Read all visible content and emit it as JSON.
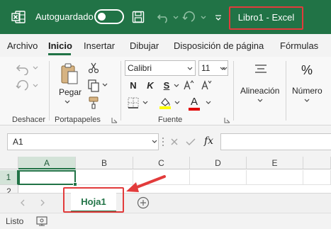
{
  "titlebar": {
    "app_icon": "excel-logo-icon",
    "autosave_label": "Autoguardado",
    "autosave_state": "off",
    "title": "Libro1  -  Excel",
    "bg_color": "#217346",
    "highlight_color": "#e23b3b"
  },
  "menu": {
    "tabs": [
      "Archivo",
      "Inicio",
      "Insertar",
      "Dibujar",
      "Disposición de página",
      "Fórmulas"
    ],
    "active": "Inicio"
  },
  "ribbon": {
    "groups": {
      "undo": "Deshacer",
      "clipboard": "Portapapeles",
      "font": "Fuente"
    },
    "paste_label": "Pegar",
    "font_name": "Calibri",
    "font_size": "11",
    "bold": "N",
    "italic": "K",
    "underline": "S",
    "font_color_letter": "A",
    "align_label": "Alineación",
    "number_label": "Número",
    "percent_symbol": "%"
  },
  "formula_bar": {
    "name_box": "A1",
    "fx_label": "fx",
    "value": ""
  },
  "grid": {
    "columns": [
      "A",
      "B",
      "C",
      "D",
      "E"
    ],
    "rows": [
      "1",
      "2"
    ],
    "active_cell": "A1"
  },
  "sheets": {
    "tabs": [
      "Hoja1"
    ],
    "active": "Hoja1"
  },
  "status": {
    "text": "Listo"
  }
}
